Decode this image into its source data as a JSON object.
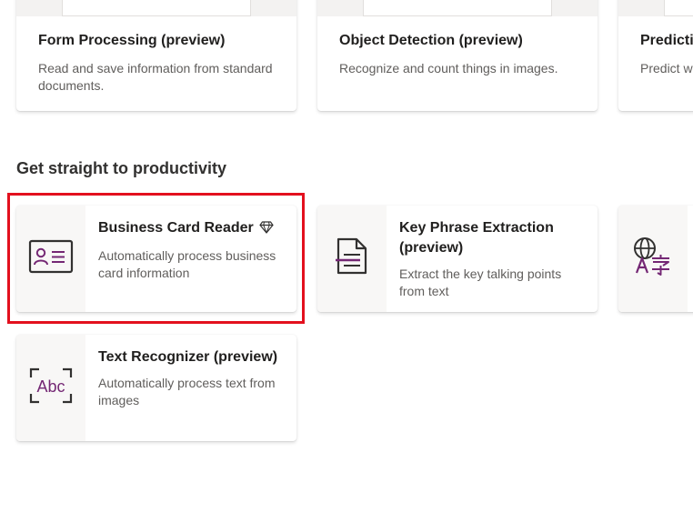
{
  "top_row": [
    {
      "title": "Form Processing (preview)",
      "description": "Read and save information from standard documents."
    },
    {
      "title": "Object Detection (preview)",
      "description": "Recognize and count things in images."
    },
    {
      "title": "Predicti",
      "description": "Predict w"
    }
  ],
  "section": {
    "title": "Get straight to productivity"
  },
  "cards": {
    "business_card": {
      "title": "Business Card Reader",
      "description": "Automatically process business card information",
      "icon": "business-card-icon",
      "premium_icon": "diamond-icon"
    },
    "key_phrase": {
      "title": "Key Phrase Extraction (preview)",
      "description": "Extract the key talking points from text",
      "icon": "key-phrase-icon"
    },
    "language": {
      "icon": "language-translation-icon"
    },
    "text_recognizer": {
      "title": "Text Recognizer (preview)",
      "description": "Automatically process text from images",
      "icon_text": "Abc",
      "icon": "text-recognizer-icon"
    }
  },
  "colors": {
    "accent": "#742774",
    "highlight": "#e3101e",
    "icon_dark": "#323130"
  }
}
